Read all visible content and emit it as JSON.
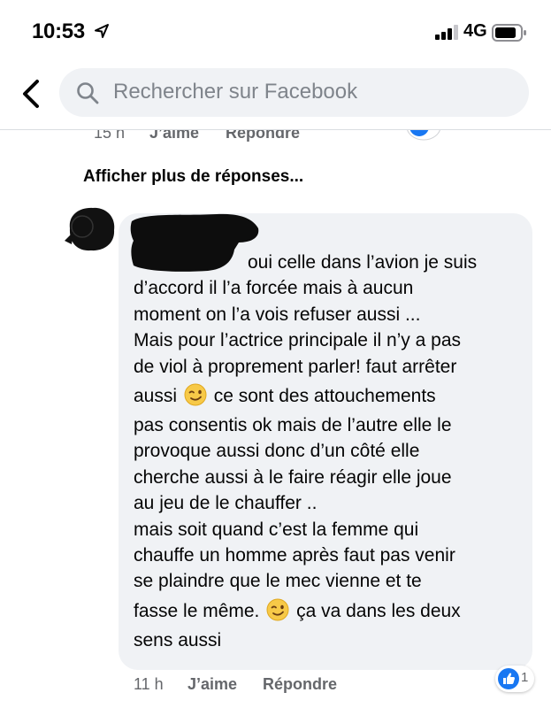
{
  "status_bar": {
    "time": "10:53",
    "network": "4G"
  },
  "header": {
    "search_placeholder": "Rechercher sur Facebook"
  },
  "previous_comment": {
    "time": "15 h",
    "like_label": "J’aime",
    "reply_label": "Répondre"
  },
  "more_replies_label": "Afficher plus de réponses...",
  "comment": {
    "lines": [
      "oui celle dans l’avion je suis",
      "d’accord il l’a forcée mais à aucun",
      "moment on l’a vois refuser aussi ...",
      "Mais pour l’actrice principale il n’y a pas",
      "de viol à proprement parler! faut arrêter",
      "aussi ",
      " ce sont des attouchements",
      "pas consentis ok mais de l’autre elle le",
      "provoque aussi donc d’un côté elle",
      "cherche aussi à le faire réagir elle joue",
      "au jeu de le chauffer ..",
      "mais soit quand c’est la femme qui",
      "chauffe un homme après faut pas venir",
      "se plaindre que le mec vienne et te",
      "fasse le même. ",
      " ça va dans les deux",
      "sens aussi"
    ],
    "emoji": "winking-face",
    "time": "11 h",
    "like_label": "J’aime",
    "reply_label": "Répondre",
    "reaction_count": "1"
  },
  "colors": {
    "bubble": "#f0f2f5",
    "secondary_text": "#65676b",
    "like_blue": "#1877f2"
  }
}
